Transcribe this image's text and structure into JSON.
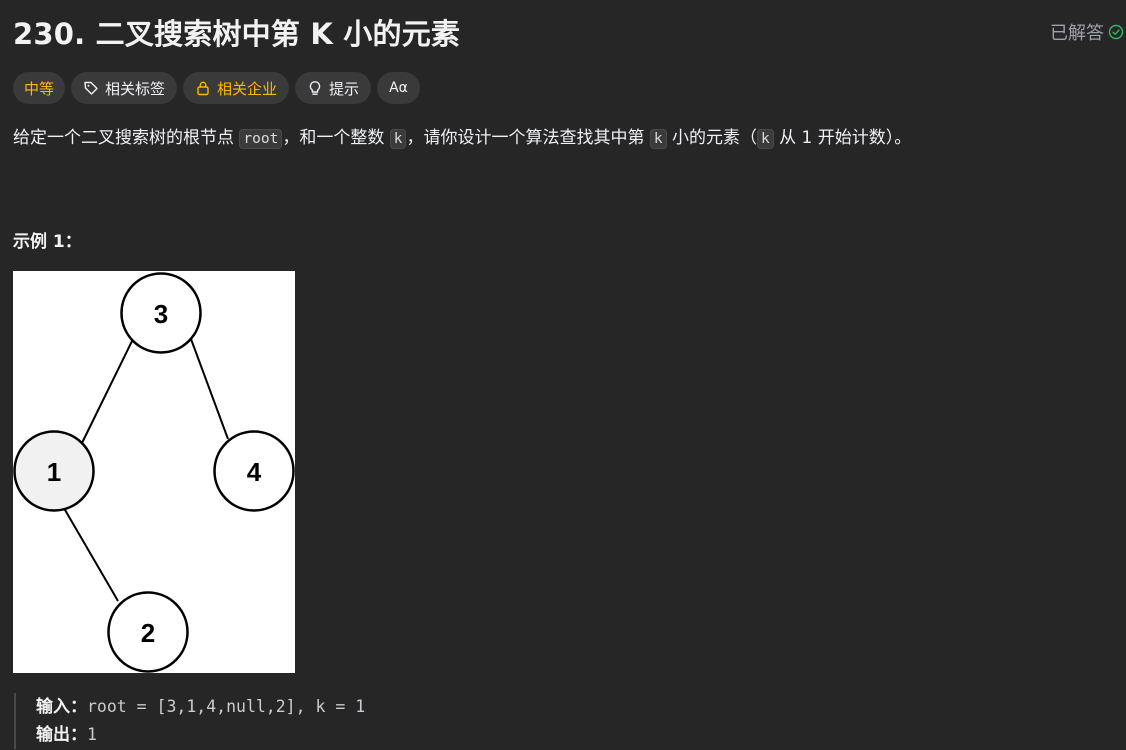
{
  "problem": {
    "title": "230. 二叉搜索树中第 K 小的元素",
    "status": "已解答"
  },
  "tags": {
    "difficulty": "中等",
    "related_tags": "相关标签",
    "related_companies": "相关企业",
    "hint": "提示",
    "font": "Aα"
  },
  "description": {
    "part1": "给定一个二叉搜索树的根节点 ",
    "code_root": "root",
    "part2": "，和一个整数 ",
    "code_k1": "k",
    "part3": "，请你设计一个算法查找其中第 ",
    "code_k2": "k",
    "part4": " 小的元素（",
    "code_k3": "k",
    "part5": " 从 1 开始计数）。"
  },
  "example": {
    "title": "示例 1：",
    "tree_nodes": [
      "3",
      "1",
      "4",
      "2"
    ],
    "input_label": "输入：",
    "input_value": "root = [3,1,4,null,2], k = 1",
    "output_label": "输出：",
    "output_value": "1"
  },
  "colors": {
    "accent_medium": "#ffb800",
    "solved_green": "#2cbb5d"
  }
}
